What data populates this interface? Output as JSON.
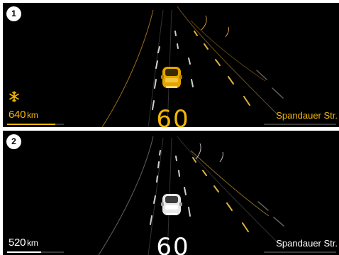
{
  "panels": [
    {
      "badge": "1",
      "range_value": "640",
      "range_unit": "km",
      "speed": "60",
      "street": "Spandauer Str.",
      "accent": "#f2b705",
      "car_color": "#e3a600",
      "frost_icon": "snowflake-icon",
      "range_fill": 0.85
    },
    {
      "badge": "2",
      "range_value": "520",
      "range_unit": "km",
      "speed": "60",
      "street": "Spandauer Str.",
      "accent": "#ffffff",
      "car_color": "#e8e8e8",
      "range_fill": 0.6
    }
  ]
}
